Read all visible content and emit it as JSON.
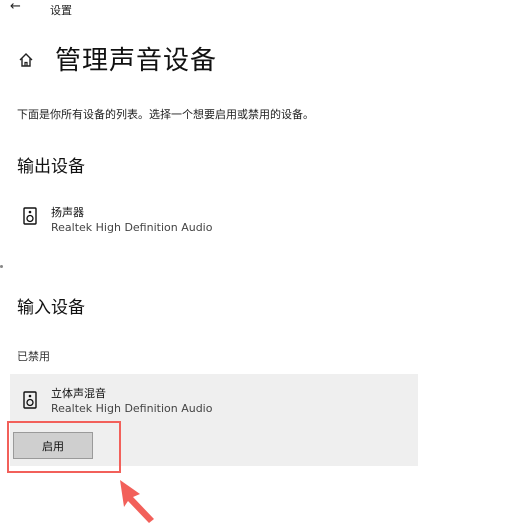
{
  "header": {
    "back_icon": "back-arrow-icon",
    "breadcrumb": "设置"
  },
  "page": {
    "title": "管理声音设备",
    "description": "下面是你所有设备的列表。选择一个想要启用或禁用的设备。"
  },
  "output_section": {
    "heading": "输出设备",
    "devices": [
      {
        "name": "扬声器",
        "driver": "Realtek High Definition Audio",
        "icon": "speaker-icon"
      }
    ]
  },
  "input_section": {
    "heading": "输入设备",
    "status": "已禁用",
    "devices": [
      {
        "name": "立体声混音",
        "driver": "Realtek High Definition Audio",
        "icon": "speaker-icon",
        "action": "启用"
      }
    ]
  },
  "colors": {
    "highlight": "#f2605a",
    "panel": "#efefef",
    "button": "#cfcfcf"
  }
}
